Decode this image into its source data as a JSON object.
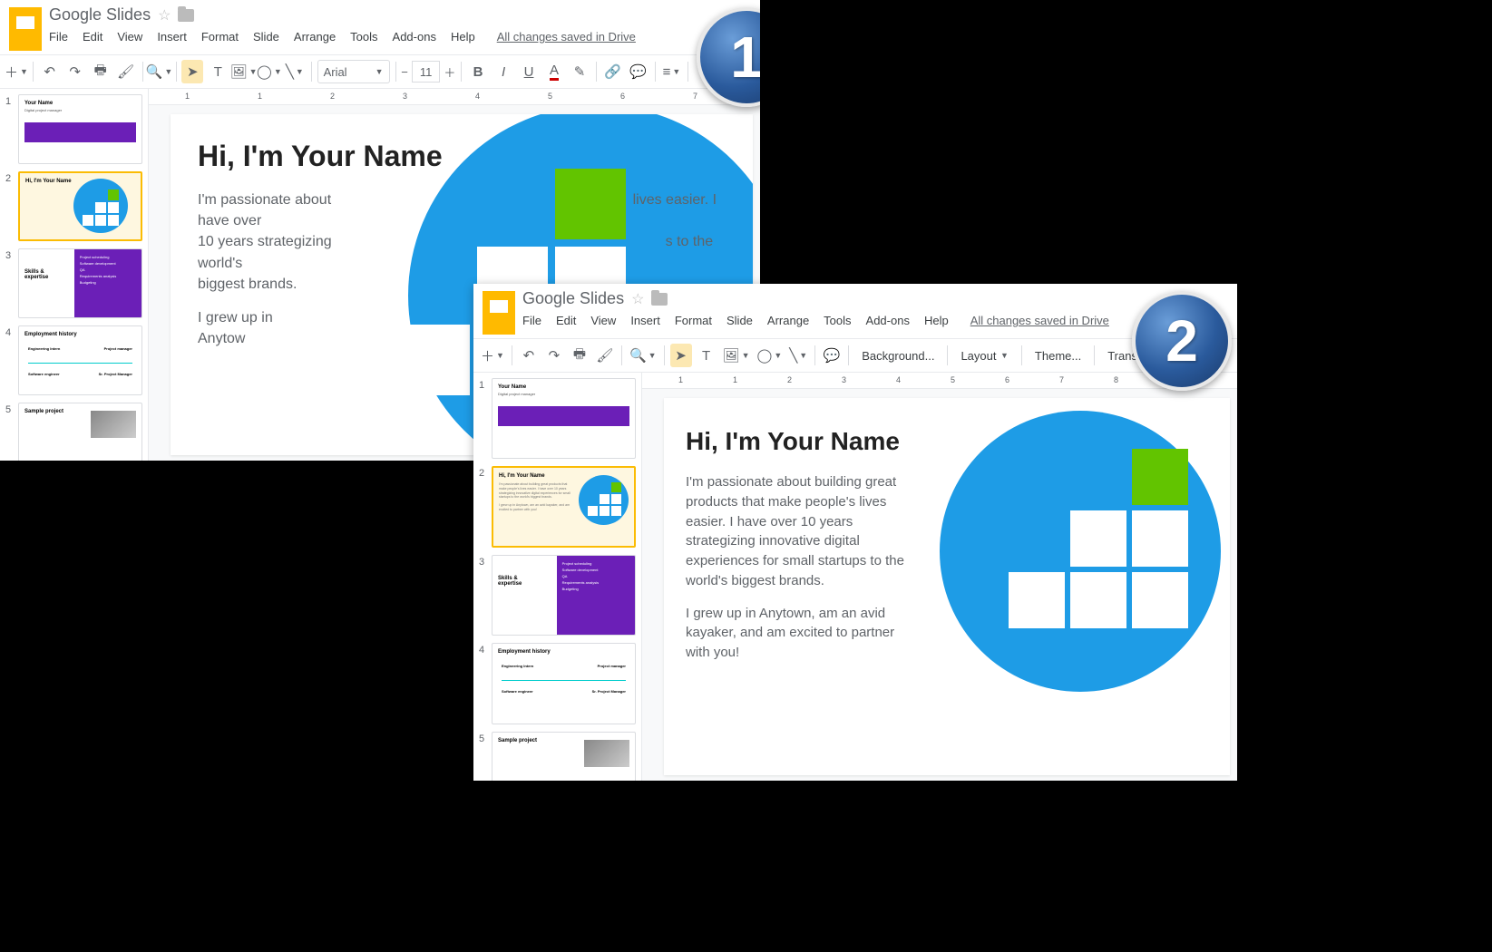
{
  "app": {
    "title": "Google Slides",
    "saved": "All changes saved in Drive"
  },
  "menus": {
    "file": "File",
    "edit": "Edit",
    "view": "View",
    "insert": "Insert",
    "format": "Format",
    "slide": "Slide",
    "arrange": "Arrange",
    "tools": "Tools",
    "addons": "Add-ons",
    "help": "Help"
  },
  "toolbar1": {
    "font": "Arial",
    "size": "11"
  },
  "toolbar2": {
    "bg": "Background...",
    "layout": "Layout",
    "theme": "Theme...",
    "transition": "Transition..."
  },
  "slide2": {
    "title": "Hi, I'm Your Name",
    "p1": "I'm passionate about building great products that make people's lives easier. I have over 10 years strategizing innovative digital experiences for small startups to the world's biggest brands.",
    "p2": "I grew up in Anytown, am an avid kayaker, and am excited to partner with you!",
    "p1_short": "I'm passionate about building great products that make people's lives easier. I have over 10 years strategizing innovative digital experiences for small startups to the world's biggest brands.",
    "p1_trunc_a": "I'm passionate about ",
    "p1_trunc_b": "lives easier. I have over",
    "p1_line2a": "10 years strategizing",
    "p1_line2b": "s to the world's",
    "p1_line3": "biggest brands.",
    "p2_trunc_a": "I grew up in Anytow",
    "p2_trunc_b": "with you!"
  },
  "thumbs": {
    "t1": {
      "title": "Your Name",
      "sub": "Digital project manager"
    },
    "t2": {
      "title": "Hi, I'm Your Name"
    },
    "t3": {
      "title": "Skills & expertise",
      "items": [
        "Project scheduling",
        "Software development",
        "QA",
        "Requirements analysis",
        "Budgeting"
      ]
    },
    "t4": {
      "title": "Employment history",
      "a": "Engineering Intern",
      "b": "Project manager",
      "c": "Software engineer",
      "d": "Sr. Project Manager"
    },
    "t5": {
      "title": "Sample project"
    }
  },
  "badges": {
    "one": "1",
    "two": "2"
  }
}
